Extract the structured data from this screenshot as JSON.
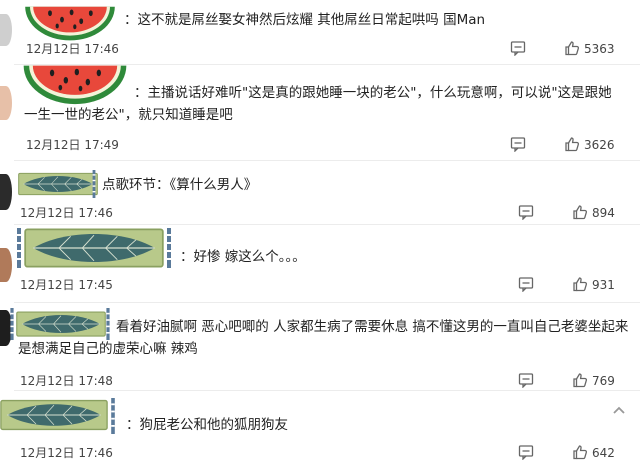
{
  "comments": [
    {
      "text": "：这不就是屌丝娶女神然后炫耀 其他屌丝日常起哄吗 国Man",
      "date": "12月12日 17:46",
      "likes": "5363",
      "badge": "watermelon"
    },
    {
      "text": "：主播说话好难听\"这是真的跟她睡一块的老公\"，什么玩意啊，可以说\"这是跟她一生一世的老公\"，就只知道睡是吧",
      "date": "12月12日 17:49",
      "likes": "3626",
      "badge": "watermelon"
    },
    {
      "text": "点歌环节：《算什么男人》",
      "date": "12月12日 17:46",
      "likes": "894",
      "badge": "leaf-small"
    },
    {
      "text": "：好惨 嫁这么个。。。",
      "date": "12月12日 17:45",
      "likes": "931",
      "badge": "leaf-large"
    },
    {
      "text": "看着好油腻啊 恶心吧唧的 人家都生病了需要休息 搞不懂这男的一直叫自己老婆坐起来是想满足自己的虚荣心嘛 辣鸡",
      "date": "12月12日 17:48",
      "likes": "769",
      "badge": "leaf-medium"
    },
    {
      "text": "：狗屁老公和他的狐朋狗友",
      "date": "12月12日 17:46",
      "likes": "642",
      "badge": "leaf-medium"
    }
  ],
  "icons": {
    "reply": "comment-icon",
    "like": "thumbs-up-icon",
    "scroll": "scroll-top-icon"
  },
  "colors": {
    "watermelon_red": "#e8483b",
    "watermelon_green": "#2f8a3a",
    "leaf_dark": "#3f6a6c",
    "leaf_bg": "#b8c98a"
  }
}
